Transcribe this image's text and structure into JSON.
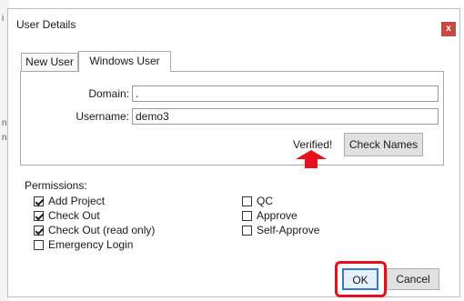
{
  "dialog": {
    "title": "User Details",
    "close_glyph": "x"
  },
  "tabs": [
    {
      "label": "New User",
      "selected": false
    },
    {
      "label": "Windows User",
      "selected": true
    }
  ],
  "form": {
    "domain_label": "Domain:",
    "domain_value": ".",
    "username_label": "Username:",
    "username_value": "demo3",
    "verified_text": "Verified!",
    "check_names_label": "Check Names"
  },
  "permissions": {
    "label": "Permissions:",
    "items": [
      {
        "label": "Add Project",
        "checked": true
      },
      {
        "label": "Check Out",
        "checked": true
      },
      {
        "label": "Check Out (read only)",
        "checked": true
      },
      {
        "label": "Emergency Login",
        "checked": false
      },
      {
        "label": "QC",
        "checked": false
      },
      {
        "label": "Approve",
        "checked": false
      },
      {
        "label": "Self-Approve",
        "checked": false
      }
    ]
  },
  "buttons": {
    "ok_label": "OK",
    "cancel_label": "Cancel"
  },
  "background": {
    "edge_marks": [
      "i",
      "n",
      "n"
    ]
  },
  "colors": {
    "close_button": "#c9483f",
    "annotation_red": "#e8101c",
    "default_button_border": "#3c78c8"
  },
  "icons": {
    "close": "close-icon",
    "annotation_arrow": "up-arrow-icon",
    "checkmark": "checkmark-icon"
  }
}
